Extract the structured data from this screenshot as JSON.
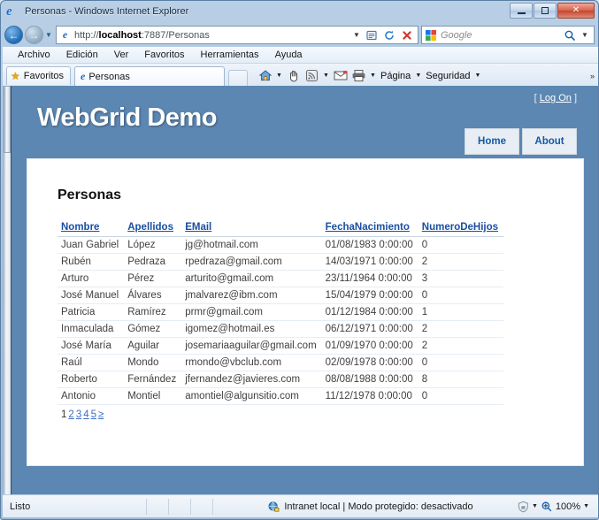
{
  "browser": {
    "window_title": "Personas - Windows Internet Explorer",
    "window_buttons": {
      "minimize": "minimize-button",
      "maximize": "maximize-button",
      "close": "close-button"
    },
    "address": {
      "scheme": "http://",
      "host": "localhost",
      "rest": ":7887/Personas",
      "full": "http://localhost:7887/Personas"
    },
    "search": {
      "placeholder": "Google"
    },
    "menu": [
      "Archivo",
      "Edición",
      "Ver",
      "Favoritos",
      "Herramientas",
      "Ayuda"
    ],
    "favorites_label": "Favoritos",
    "tab_label": "Personas",
    "command_bar": {
      "pagina": "Página",
      "seguridad": "Seguridad",
      "overflow": "»"
    },
    "status": {
      "left": "Listo",
      "zone": "Intranet local | Modo protegido: desactivado",
      "zoom": "100%"
    }
  },
  "page": {
    "logon_bracket_open": "[",
    "logon_label": "Log On",
    "logon_bracket_close": "]",
    "site_title": "WebGrid Demo",
    "nav": [
      {
        "label": "Home"
      },
      {
        "label": "About"
      }
    ],
    "heading": "Personas",
    "grid": {
      "columns": [
        {
          "label": "Nombre",
          "key": "nombre"
        },
        {
          "label": "Apellidos",
          "key": "apellidos"
        },
        {
          "label": "EMail",
          "key": "email"
        },
        {
          "label": "FechaNacimiento",
          "key": "fecha"
        },
        {
          "label": "NumeroDeHijos",
          "key": "hijos"
        }
      ],
      "rows": [
        {
          "nombre": "Juan Gabriel",
          "apellidos": "López",
          "email": "jg@hotmail.com",
          "fecha": "01/08/1983 0:00:00",
          "hijos": "0"
        },
        {
          "nombre": "Rubén",
          "apellidos": "Pedraza",
          "email": "rpedraza@gmail.com",
          "fecha": "14/03/1971 0:00:00",
          "hijos": "2"
        },
        {
          "nombre": "Arturo",
          "apellidos": "Pérez",
          "email": "arturito@gmail.com",
          "fecha": "23/11/1964 0:00:00",
          "hijos": "3"
        },
        {
          "nombre": "José Manuel",
          "apellidos": "Álvares",
          "email": "jmalvarez@ibm.com",
          "fecha": "15/04/1979 0:00:00",
          "hijos": "0"
        },
        {
          "nombre": "Patricia",
          "apellidos": "Ramírez",
          "email": "prmr@gmail.com",
          "fecha": "01/12/1984 0:00:00",
          "hijos": "1"
        },
        {
          "nombre": "Inmaculada",
          "apellidos": "Gómez",
          "email": "igomez@hotmail.es",
          "fecha": "06/12/1971 0:00:00",
          "hijos": "2"
        },
        {
          "nombre": "José María",
          "apellidos": "Aguilar",
          "email": "josemariaaguilar@gmail.com",
          "fecha": "01/09/1970 0:00:00",
          "hijos": "2"
        },
        {
          "nombre": "Raúl",
          "apellidos": "Mondo",
          "email": "rmondo@vbclub.com",
          "fecha": "02/09/1978 0:00:00",
          "hijos": "0"
        },
        {
          "nombre": "Roberto",
          "apellidos": "Fernández",
          "email": "jfernandez@javieres.com",
          "fecha": "08/08/1988 0:00:00",
          "hijos": "8"
        },
        {
          "nombre": "Antonio",
          "apellidos": "Montiel",
          "email": "amontiel@algunsitio.com",
          "fecha": "11/12/1978 0:00:00",
          "hijos": "0"
        }
      ],
      "pager": {
        "current": "1",
        "links": [
          "2",
          "3",
          "4",
          "5",
          "≥"
        ]
      }
    }
  },
  "colors": {
    "header_blue": "#5C87B2",
    "link_blue": "#1A4FA0",
    "nav_tab_bg": "#E8EEF4",
    "nav_tab_text": "#1559A8",
    "card_bg": "#FFFFFF"
  }
}
